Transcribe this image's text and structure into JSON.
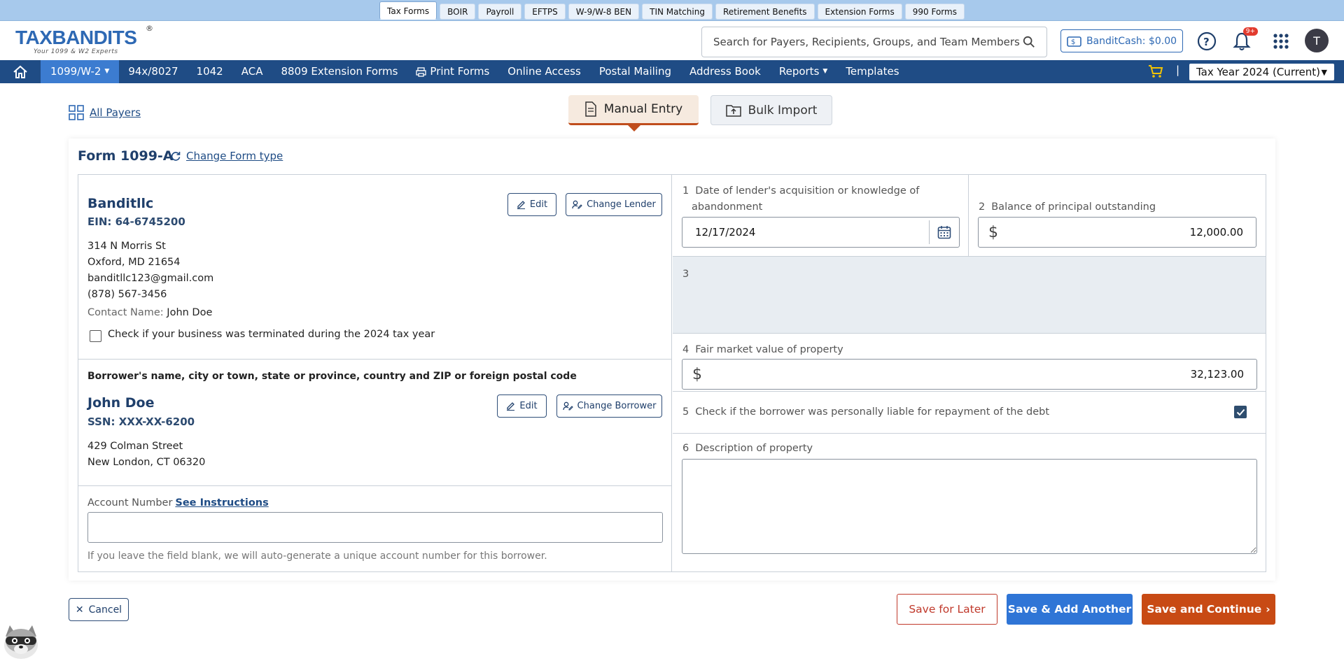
{
  "product_tabs": [
    "Tax Forms",
    "BOIR",
    "Payroll",
    "EFTPS",
    "W-9/W-8 BEN",
    "TIN Matching",
    "Retirement Benefits",
    "Extension Forms",
    "990 Forms"
  ],
  "header": {
    "logo_text": "TAXBANDITS",
    "logo_tagline": "Your 1099 & W2 Experts",
    "logo_reg": "®",
    "search_placeholder": "Search for Payers, Recipients, Groups, and Team Members",
    "bandit_cash": "BanditCash: $0.00",
    "notification_count": "9+",
    "avatar_initial": "T"
  },
  "nav": {
    "items": [
      "1099/W-2",
      "94x/8027",
      "1042",
      "ACA",
      "8809 Extension Forms",
      "Print Forms",
      "Online Access",
      "Postal Mailing",
      "Address Book",
      "Reports",
      "Templates"
    ],
    "separator": "|",
    "tax_year": "Tax Year 2024 (Current)"
  },
  "entry": {
    "all_payers": "All Payers",
    "manual_entry": "Manual Entry",
    "bulk_import": "Bulk Import"
  },
  "form": {
    "title": "Form 1099-A",
    "change_form_type": "Change Form type"
  },
  "payer": {
    "name": "Banditllc",
    "ein": "EIN: 64-6745200",
    "address1": "314 N Morris St",
    "address2": "Oxford, MD 21654",
    "email": "banditllc123@gmail.com",
    "phone": "(878) 567-3456",
    "contact_label": "Contact Name:",
    "contact_name": "John Doe",
    "edit_label": "Edit",
    "change_label": "Change Lender",
    "terminated_label": "Check if your business was terminated during the 2024 tax year"
  },
  "borrower": {
    "section_heading": "Borrower's name, city or town, state or province, country and ZIP or foreign postal code",
    "name": "John Doe",
    "ssn": "SSN: XXX-XX-6200",
    "address1": "429 Colman Street",
    "address2": "New London, CT 06320",
    "edit_label": "Edit",
    "change_label": "Change Borrower"
  },
  "account": {
    "label": "Account Number",
    "link": "See Instructions",
    "value": "",
    "help": "If you leave the field blank, we will auto-generate a unique account number for this borrower."
  },
  "boxes": {
    "box1_num": "1",
    "box1_label_line1": "Date of lender's acquisition or knowledge of",
    "box1_label_line2": "abandonment",
    "box1_value": "12/17/2024",
    "box2_num": "2",
    "box2_label": "Balance of principal outstanding",
    "box2_currency": "$",
    "box2_value": "12,000.00",
    "box3_num": "3",
    "box4_num": "4",
    "box4_label": "Fair market value of property",
    "box4_currency": "$",
    "box4_value": "32,123.00",
    "box5_num": "5",
    "box5_label": "Check if the borrower was personally liable for repayment of the debt",
    "box5_checked": true,
    "box6_num": "6",
    "box6_label": "Description of property",
    "box6_value": ""
  },
  "footer": {
    "cancel": "Cancel",
    "save_later": "Save for Later",
    "save_another": "Save & Add Another",
    "save_continue": "Save and Continue"
  },
  "colors": {
    "nav_bg": "#1f4c85",
    "nav_active": "#3c7cd0",
    "brand_blue": "#2e69b4",
    "brand_orange": "#e9572a",
    "continue_btn": "#c84a14",
    "another_btn": "#2f75d6"
  }
}
